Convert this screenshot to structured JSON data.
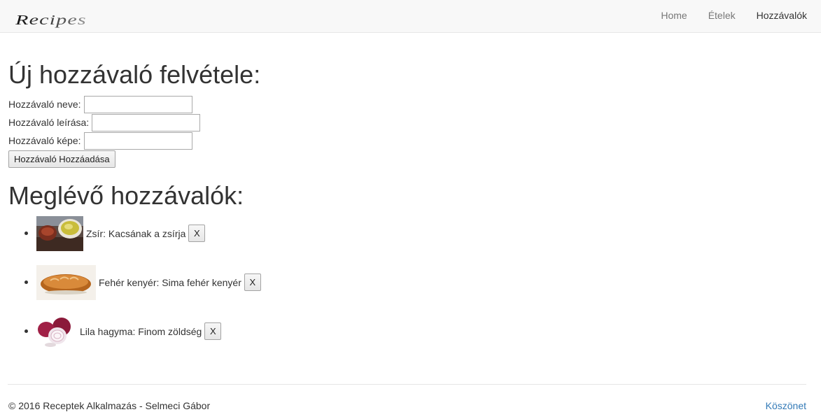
{
  "navbar": {
    "brand_logo": "Recipes",
    "links": [
      {
        "label": "Home",
        "active": false
      },
      {
        "label": "Ételek",
        "active": false
      },
      {
        "label": "Hozzávalók",
        "active": true
      }
    ]
  },
  "add_section": {
    "heading": "Új hozzávaló felvétele:",
    "name_label": "Hozzávaló neve:",
    "name_value": "",
    "description_label": "Hozzávaló leírása:",
    "description_value": "",
    "image_label": "Hozzávaló képe:",
    "image_value": "",
    "submit_label": "Hozzávaló Hozzáadása"
  },
  "existing_section": {
    "heading": "Meglévő hozzávalók:",
    "items": [
      {
        "text": "Zsír: Kacsának a zsírja",
        "image": "duck-fat-photo",
        "delete_label": "X"
      },
      {
        "text": "Fehér kenyér: Sima fehér kenyér",
        "image": "white-bread-photo",
        "delete_label": "X"
      },
      {
        "text": "Lila hagyma: Finom zöldség",
        "image": "red-onion-photo",
        "delete_label": "X"
      }
    ]
  },
  "footer": {
    "copyright": "© 2016 Receptek Alkalmazás - Selmeci Gábor",
    "thanks_link": "Köszönet"
  },
  "colors": {
    "navbar_bg": "#f8f8f8",
    "link": "#337ab7",
    "text": "#333333"
  }
}
